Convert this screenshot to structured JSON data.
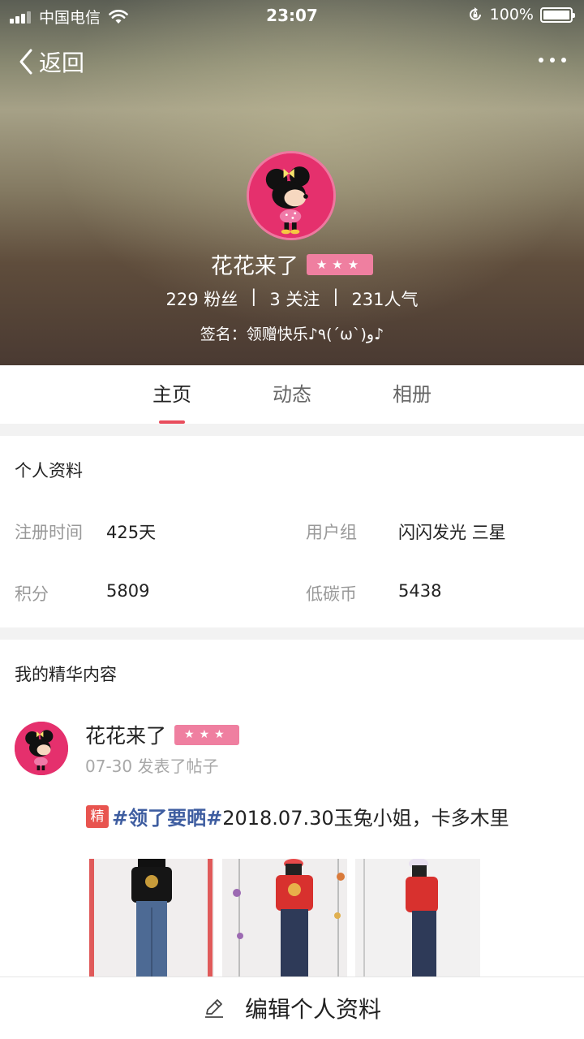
{
  "status_bar": {
    "carrier": "中国电信",
    "time": "23:07",
    "battery": "100%"
  },
  "nav": {
    "back_label": "返回",
    "more_icon": "more-dots-icon"
  },
  "profile_header": {
    "name": "花花来了",
    "stars": "★★★",
    "fans": "229 粉丝",
    "follows": "3 关注",
    "popularity": "231人气",
    "separator": "|",
    "signature": "签名：领赠快乐♪٩(´ω`)و♪"
  },
  "tabs": [
    {
      "label": "主页",
      "active": true
    },
    {
      "label": "动态",
      "active": false
    },
    {
      "label": "相册",
      "active": false
    }
  ],
  "profile_info": {
    "title": "个人资料",
    "fields": [
      {
        "label": "注册时间",
        "value": "425天"
      },
      {
        "label": "用户组",
        "value": "闪闪发光 三星"
      },
      {
        "label": "积分",
        "value": "5809"
      },
      {
        "label": "低碳币",
        "value": "5438"
      }
    ]
  },
  "featured": {
    "title": "我的精华内容",
    "post": {
      "author": "花花来了",
      "stars": "★★★",
      "time": "07-30 发表了帖子",
      "badge": "精",
      "topic": "#领了要晒#",
      "text": "2018.07.30玉兔小姐，卡多木里"
    }
  },
  "bottom": {
    "edit_label": "编辑个人资料"
  },
  "colors": {
    "accent": "#e84d5c",
    "badge_pink": "#ef7fa0",
    "topic_blue": "#3e5da0",
    "jing_red": "#e8544f"
  }
}
